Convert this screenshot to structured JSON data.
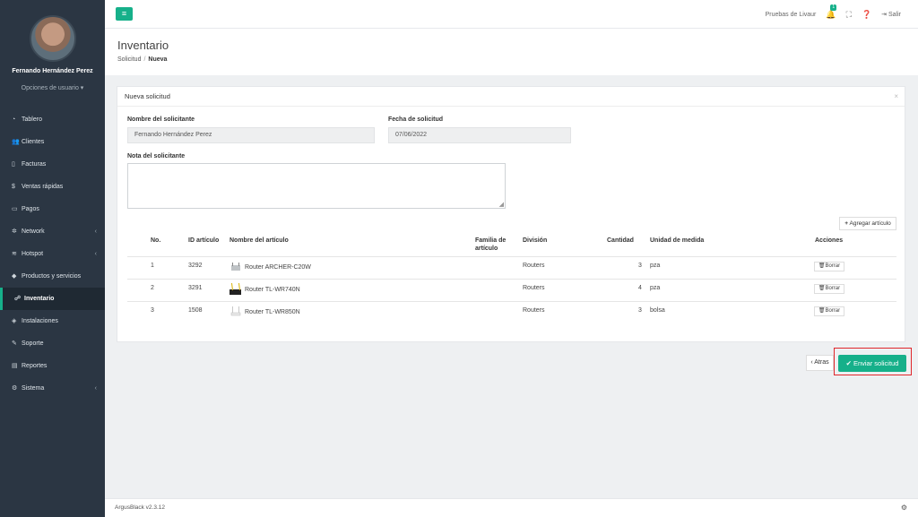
{
  "user": {
    "name": "Fernando Hernández Perez",
    "options_label": "Opciones de usuario ▾"
  },
  "nav": [
    {
      "label": "Tablero",
      "icon": "◔",
      "chevron": ""
    },
    {
      "label": "Clientes",
      "icon": "👥",
      "chevron": ""
    },
    {
      "label": "Facturas",
      "icon": "▯",
      "chevron": ""
    },
    {
      "label": "Ventas rápidas",
      "icon": "$",
      "chevron": ""
    },
    {
      "label": "Pagos",
      "icon": "▭",
      "chevron": ""
    },
    {
      "label": "Network",
      "icon": "✲",
      "chevron": "‹"
    },
    {
      "label": "Hotspot",
      "icon": "≋",
      "chevron": "‹"
    },
    {
      "label": "Productos y servicios",
      "icon": "◆",
      "chevron": ""
    },
    {
      "label": "Inventario",
      "icon": "☍",
      "chevron": ""
    },
    {
      "label": "Instalaciones",
      "icon": "◈",
      "chevron": ""
    },
    {
      "label": "Soporte",
      "icon": "✎",
      "chevron": ""
    },
    {
      "label": "Reportes",
      "icon": "▤",
      "chevron": ""
    },
    {
      "label": "Sistema",
      "icon": "⚙",
      "chevron": "‹"
    }
  ],
  "topbar": {
    "account": "Pruebas de Livaur",
    "notif_count": "1",
    "logout": "Salir"
  },
  "page": {
    "title": "Inventario",
    "breadcrumb_parent": "Solicitud",
    "breadcrumb_current": "Nueva"
  },
  "card": {
    "title": "Nueva solicitud",
    "close": "×",
    "requester_label": "Nombre del solicitante",
    "requester_value": "Fernando Hernández Perez",
    "date_label": "Fecha de solicitud",
    "date_value": "07/06/2022",
    "note_label": "Nota del solicitante",
    "add_item_label": "Agregar artículo"
  },
  "table": {
    "headers": [
      "No.",
      "ID artículo",
      "Nombre del artículo",
      "Familia de artículo",
      "División",
      "Cantidad",
      "Unidad de medida",
      "Acciones"
    ],
    "rows": [
      {
        "no": "1",
        "id": "3292",
        "name": "Router ARCHER-C20W",
        "family": "",
        "division": "Routers",
        "qty": "3",
        "unit": "pza",
        "action": "Borrar"
      },
      {
        "no": "2",
        "id": "3291",
        "name": "Router TL-WR740N",
        "family": "",
        "division": "Routers",
        "qty": "4",
        "unit": "pza",
        "action": "Borrar"
      },
      {
        "no": "3",
        "id": "1508",
        "name": "Router TL-WR850N",
        "family": "",
        "division": "Routers",
        "qty": "3",
        "unit": "bolsa",
        "action": "Borrar"
      }
    ]
  },
  "actions": {
    "back": "‹ Atras",
    "submit": "✔ Enviar solicitud"
  },
  "footer": {
    "version": "ArgusBlack v2.3.12"
  },
  "colors": {
    "accent": "#16b08a",
    "sidebar": "#2b3643",
    "highlight": "#e0262b"
  }
}
